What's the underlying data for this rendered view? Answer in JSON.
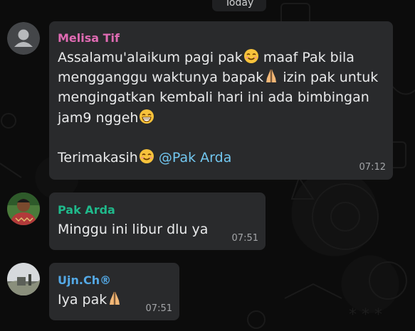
{
  "date_divider": "Today",
  "messages": [
    {
      "sender": "Melisa Tif",
      "sender_color": "#e06bb3",
      "lines": [
        "Assalamu'alaikum pagi pak",
        "maaf Pak bila",
        "mengganggu waktunya bapak",
        "izin pak untuk",
        "mengingatkan kembali  hari ini ada bimbingan",
        "jam9 nggeh",
        "Terimakasih",
        "@Pak Arda"
      ],
      "time": "07:12",
      "avatar_icon": "default-user-avatar-icon"
    },
    {
      "sender": "Pak Arda",
      "sender_color": "#1fb98b",
      "lines": [
        "Minggu ini libur dlu ya"
      ],
      "time": "07:51",
      "avatar_icon": "profile-photo"
    },
    {
      "sender": "Ujn.Ch®",
      "sender_color": "#54a9e6",
      "lines": [
        "Iya pak"
      ],
      "time": "07:51",
      "avatar_icon": "profile-photo"
    }
  ],
  "emoji_names": [
    "smiling-face-emoji",
    "folded-hands-emoji",
    "grinning-face-emoji"
  ]
}
